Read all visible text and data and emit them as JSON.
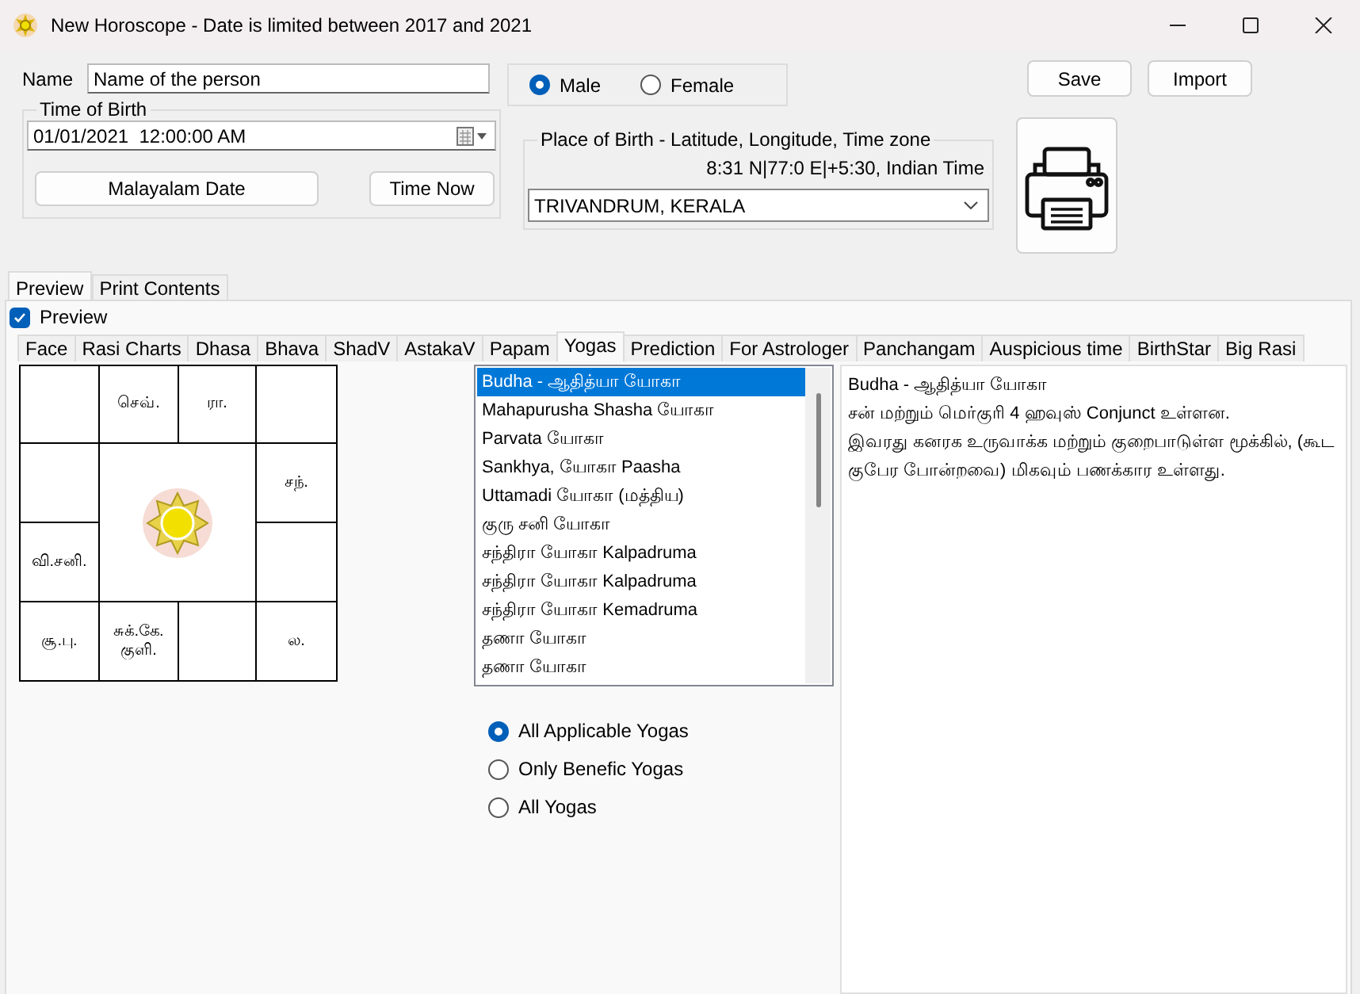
{
  "window": {
    "title": "New Horoscope - Date is limited between 2017 and 2021"
  },
  "form": {
    "name_label": "Name",
    "name_value": "Name of the person",
    "gender": [
      {
        "label": "Male",
        "selected": true
      },
      {
        "label": "Female",
        "selected": false
      }
    ],
    "buttons": [
      "Save",
      "Import"
    ],
    "time_of_birth": {
      "legend": "Time of Birth",
      "value": "01/01/2021  12:00:00 AM",
      "buttons": [
        "Malayalam Date",
        "Time Now"
      ]
    },
    "place_of_birth": {
      "legend": "Place of Birth - Latitude, Longitude, Time zone",
      "coordinates": "8:31 N|77:0 E|+5:30, Indian Time",
      "place": "TRIVANDRUM, KERALA"
    }
  },
  "outer_tabs": [
    {
      "label": "Preview",
      "selected": true
    },
    {
      "label": "Print Contents",
      "selected": false
    }
  ],
  "preview_checkbox": {
    "label": "Preview",
    "checked": true
  },
  "tabs": [
    {
      "label": "Face",
      "selected": false
    },
    {
      "label": "Rasi Charts",
      "selected": false
    },
    {
      "label": "Dhasa",
      "selected": false
    },
    {
      "label": "Bhava",
      "selected": false
    },
    {
      "label": "ShadV",
      "selected": false
    },
    {
      "label": "AstakaV",
      "selected": false
    },
    {
      "label": "Papam",
      "selected": false
    },
    {
      "label": "Yogas",
      "selected": true
    },
    {
      "label": "Prediction",
      "selected": false
    },
    {
      "label": "For Astrologer",
      "selected": false
    },
    {
      "label": "Panchangam",
      "selected": false
    },
    {
      "label": "Auspicious time",
      "selected": false
    },
    {
      "label": "BirthStar",
      "selected": false
    },
    {
      "label": "Big Rasi",
      "selected": false
    }
  ],
  "chart": {
    "cells": [
      {},
      {
        "planets": "செவ்."
      },
      {
        "planets": "ரா."
      },
      {},
      {},
      {
        "planets": "சந்."
      },
      {
        "planets": "வி.சனி."
      },
      {},
      {
        "planets": "சூ.பு."
      },
      {
        "planets": "சுக்.கே.குளி."
      },
      {},
      {
        "planets": "ல."
      }
    ]
  },
  "yogas": {
    "items": [
      {
        "label": "Budha - ஆதித்யா யோகா",
        "selected": true
      },
      {
        "label": "Mahapurusha Shasha யோகா",
        "selected": false
      },
      {
        "label": "Parvata யோகா",
        "selected": false
      },
      {
        "label": "Sankhya, யோகா Paasha",
        "selected": false
      },
      {
        "label": "Uttamadi யோகா (மத்திய)",
        "selected": false
      },
      {
        "label": "குரு சனி யோகா",
        "selected": false
      },
      {
        "label": "சந்திரா யோகா Kalpadruma",
        "selected": false
      },
      {
        "label": "சந்திரா யோகா Kalpadruma",
        "selected": false
      },
      {
        "label": "சந்திரா யோகா Kemadruma",
        "selected": false
      },
      {
        "label": "தணா யோகா",
        "selected": false
      },
      {
        "label": "தணா யோகா",
        "selected": false
      }
    ],
    "filters": [
      {
        "label": "All Applicable Yogas",
        "selected": true
      },
      {
        "label": "Only Benefic Yogas",
        "selected": false
      },
      {
        "label": "All Yogas",
        "selected": false
      }
    ],
    "description": {
      "title": "Budha - ஆதித்யா யோகா",
      "paragraphs": [
        "சன் மற்றும் மெர்குரி 4 ஹவுஸ் Conjunct உள்ளன.",
        "இவரது கனரக உருவாக்க மற்றும் குறைபாடுள்ள மூக்கில், (கூட குபேர போன்றவை) மிகவும் பணக்கார உள்ளது."
      ]
    }
  }
}
